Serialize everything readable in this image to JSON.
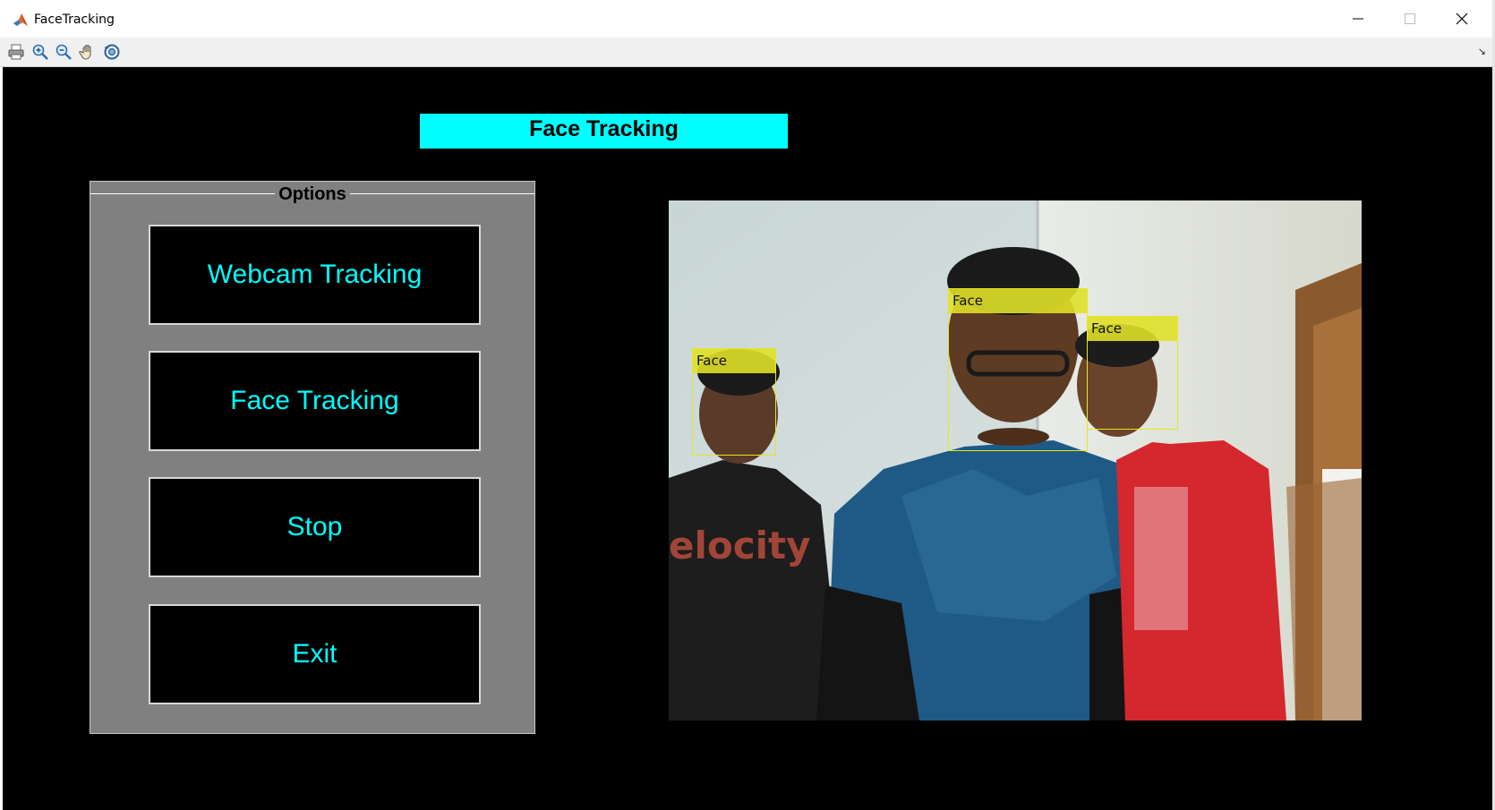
{
  "window": {
    "title": "FaceTracking"
  },
  "toolbar": {
    "tools": [
      {
        "name": "print-icon"
      },
      {
        "name": "zoom-in-icon"
      },
      {
        "name": "zoom-out-icon"
      },
      {
        "name": "pan-hand-icon"
      },
      {
        "name": "rotate-3d-icon"
      }
    ]
  },
  "app": {
    "title": "Face Tracking",
    "colors": {
      "accent": "#00ffff",
      "panel": "#808080",
      "background": "#000000",
      "face_box": "#e6e622"
    }
  },
  "options": {
    "title": "Options",
    "buttons": [
      "Webcam Tracking",
      "Face Tracking",
      "Stop",
      "Exit"
    ]
  },
  "video": {
    "faces": [
      {
        "label": "Face"
      },
      {
        "label": "Face"
      },
      {
        "label": "Face"
      }
    ]
  }
}
